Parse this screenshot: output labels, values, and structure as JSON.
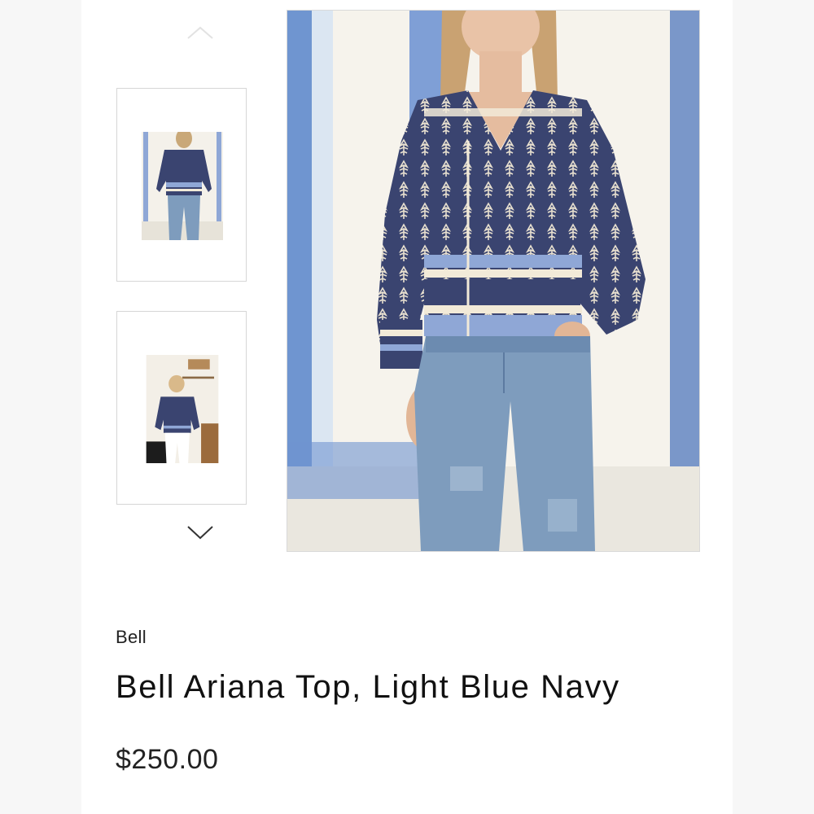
{
  "product": {
    "brand": "Bell",
    "title": "Bell Ariana Top, Light Blue Navy",
    "price": "$250.00"
  },
  "gallery": {
    "up_icon": "chevron-up-icon",
    "down_icon": "chevron-down-icon",
    "thumbnails": [
      {
        "name": "thumbnail-front-view"
      },
      {
        "name": "thumbnail-kitchen-view"
      }
    ],
    "main_image": "main-product-image"
  },
  "colors": {
    "navy": "#3a4470",
    "light_blue": "#8fa7d6",
    "cream": "#f2ead8",
    "denim": "#7e9cbd",
    "text": "#111111"
  }
}
